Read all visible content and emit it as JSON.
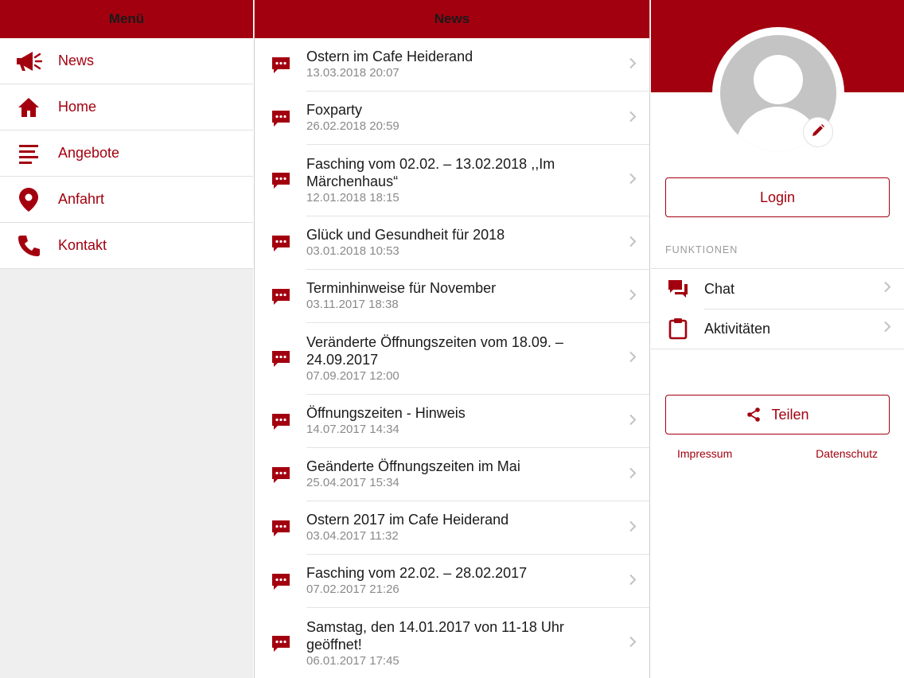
{
  "colors": {
    "brand": "#a3000f",
    "avatar_gray": "#c4c4c4"
  },
  "menu": {
    "title": "Menü",
    "items": [
      {
        "label": "News",
        "icon": "megaphone-icon"
      },
      {
        "label": "Home",
        "icon": "home-icon"
      },
      {
        "label": "Angebote",
        "icon": "list-icon"
      },
      {
        "label": "Anfahrt",
        "icon": "location-pin-icon"
      },
      {
        "label": "Kontakt",
        "icon": "phone-icon"
      }
    ]
  },
  "news": {
    "title": "News",
    "items": [
      {
        "title": "Ostern im Cafe Heiderand",
        "date": "13.03.2018 20:07"
      },
      {
        "title": "Foxparty",
        "date": "26.02.2018 20:59"
      },
      {
        "title": "Fasching vom 02.02. – 13.02.2018 ,,Im Märchenhaus“",
        "date": "12.01.2018 18:15"
      },
      {
        "title": "Glück und Gesundheit für 2018",
        "date": "03.01.2018 10:53"
      },
      {
        "title": "Terminhinweise für November",
        "date": "03.11.2017 18:38"
      },
      {
        "title": "Veränderte Öffnungszeiten vom 18.09. – 24.09.2017",
        "date": "07.09.2017 12:00"
      },
      {
        "title": "Öffnungszeiten - Hinweis",
        "date": "14.07.2017 14:34"
      },
      {
        "title": "Geänderte Öffnungszeiten im Mai",
        "date": "25.04.2017 15:34"
      },
      {
        "title": "Ostern 2017 im Cafe Heiderand",
        "date": "03.04.2017 11:32"
      },
      {
        "title": "Fasching vom 22.02. – 28.02.2017",
        "date": "07.02.2017 21:26"
      },
      {
        "title": "Samstag, den 14.01.2017 von 11-18 Uhr geöffnet!",
        "date": "06.01.2017 17:45"
      }
    ]
  },
  "profile": {
    "login_label": "Login",
    "section_label": "FUNKTIONEN",
    "functions": [
      {
        "label": "Chat",
        "icon": "chat-icon"
      },
      {
        "label": "Aktivitäten",
        "icon": "clipboard-icon"
      }
    ],
    "share_label": "Teilen",
    "impressum_label": "Impressum",
    "datenschutz_label": "Datenschutz"
  }
}
